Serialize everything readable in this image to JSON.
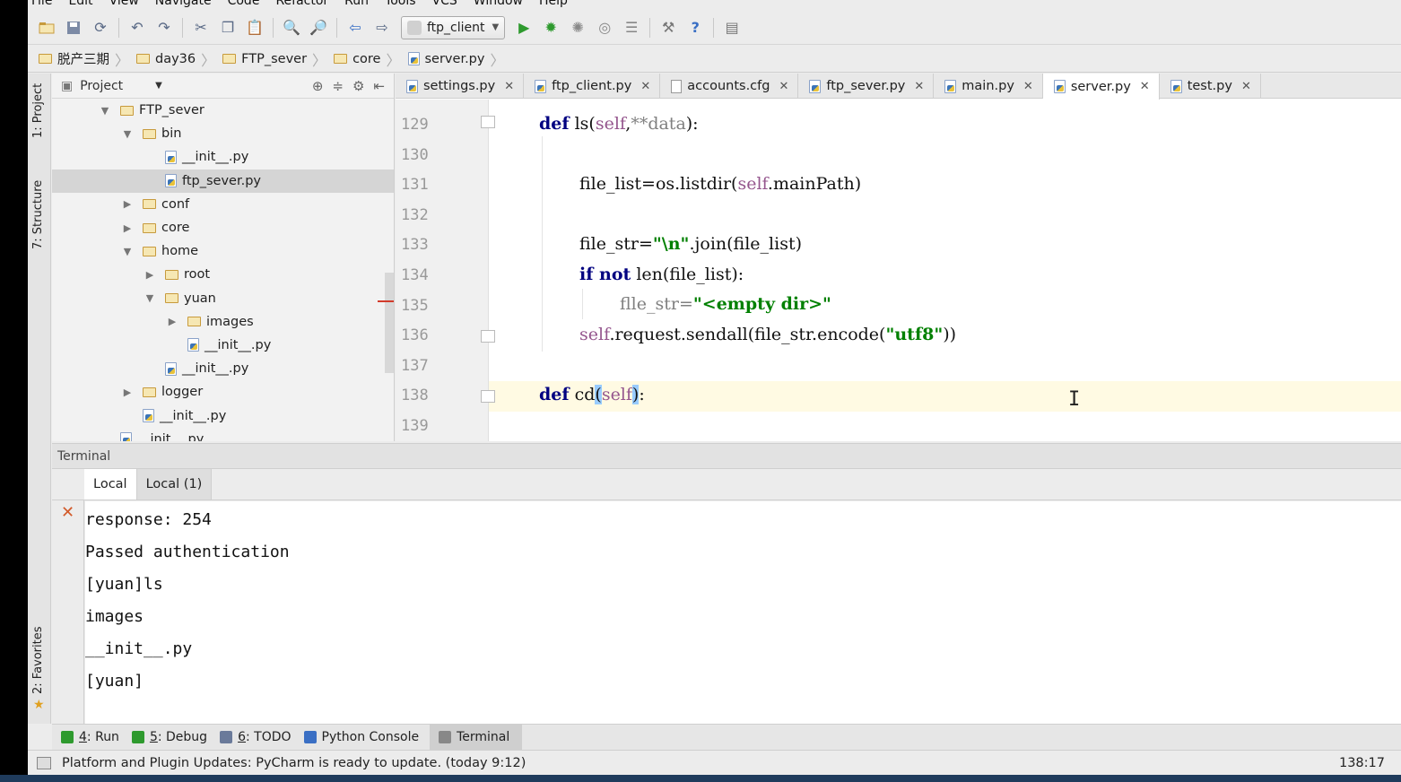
{
  "menu": [
    "File",
    "Edit",
    "View",
    "Navigate",
    "Code",
    "Refactor",
    "Run",
    "Tools",
    "VCS",
    "Window",
    "Help"
  ],
  "toolbar": {
    "run_config": "ftp_client",
    "icons": [
      "open-folder-icon",
      "save-icon",
      "sync-icon",
      "undo-icon",
      "redo-icon",
      "cut-icon",
      "copy-icon",
      "paste-icon",
      "find-icon",
      "replace-icon",
      "back-icon",
      "forward-icon",
      "run-icon",
      "debug-icon",
      "coverage-icon",
      "profile-icon",
      "concurrency-icon",
      "settings-icon",
      "help-icon",
      "sdk-icon"
    ]
  },
  "breadcrumbs": [
    "脱产三期",
    "day36",
    "FTP_sever",
    "core",
    "server.py"
  ],
  "side_tools": {
    "project": "1: Project",
    "structure": "7: Structure",
    "favorites": "2: Favorites"
  },
  "project_panel": {
    "title": "Project",
    "tree": [
      {
        "label": "FTP_sever",
        "type": "folder",
        "depth": 0,
        "state": "open"
      },
      {
        "label": "bin",
        "type": "folder",
        "depth": 1,
        "state": "open"
      },
      {
        "label": "__init__.py",
        "type": "py",
        "depth": 2,
        "state": ""
      },
      {
        "label": "ftp_sever.py",
        "type": "py",
        "depth": 2,
        "state": "",
        "selected": true
      },
      {
        "label": "conf",
        "type": "folder",
        "depth": 1,
        "state": "closed"
      },
      {
        "label": "core",
        "type": "folder",
        "depth": 1,
        "state": "closed"
      },
      {
        "label": "home",
        "type": "folder",
        "depth": 1,
        "state": "open"
      },
      {
        "label": "root",
        "type": "folder",
        "depth": 2,
        "state": "closed"
      },
      {
        "label": "yuan",
        "type": "folder",
        "depth": 2,
        "state": "open"
      },
      {
        "label": "images",
        "type": "folder",
        "depth": 3,
        "state": "closed"
      },
      {
        "label": "__init__.py",
        "type": "py",
        "depth": 3,
        "state": ""
      },
      {
        "label": "__init__.py",
        "type": "py",
        "depth": 2,
        "state": ""
      },
      {
        "label": "logger",
        "type": "folder",
        "depth": 1,
        "state": "closed"
      },
      {
        "label": "__init__.py",
        "type": "py",
        "depth": 1,
        "state": ""
      },
      {
        "label": "__init__.py",
        "type": "py",
        "depth": 0,
        "state": ""
      }
    ]
  },
  "editor": {
    "tabs": [
      {
        "label": "settings.py",
        "type": "py",
        "active": false
      },
      {
        "label": "ftp_client.py",
        "type": "py",
        "active": false
      },
      {
        "label": "accounts.cfg",
        "type": "cfg",
        "active": false
      },
      {
        "label": "ftp_sever.py",
        "type": "py",
        "active": false
      },
      {
        "label": "main.py",
        "type": "py",
        "active": false
      },
      {
        "label": "server.py",
        "type": "py",
        "active": true
      },
      {
        "label": "test.py",
        "type": "py",
        "active": false
      }
    ],
    "line_numbers": [
      "129",
      "130",
      "131",
      "132",
      "133",
      "134",
      "135",
      "136",
      "137",
      "138",
      "139"
    ]
  },
  "terminal": {
    "title": "Terminal",
    "tabs": [
      "Local",
      "Local (1)"
    ],
    "lines": [
      "response: 254",
      "Passed authentication",
      "[yuan]ls",
      "images",
      "__init__.py",
      "[yuan]"
    ]
  },
  "bottom_tools": [
    {
      "num": "4",
      "label": ": Run"
    },
    {
      "num": "5",
      "label": ": Debug"
    },
    {
      "num": "6",
      "label": ": TODO"
    },
    {
      "num": "",
      "label": "Python Console"
    },
    {
      "num": "",
      "label": "Terminal"
    }
  ],
  "status": {
    "message": "Platform and Plugin Updates: PyCharm is ready to update. (today 9:12)",
    "position": "138:17"
  }
}
